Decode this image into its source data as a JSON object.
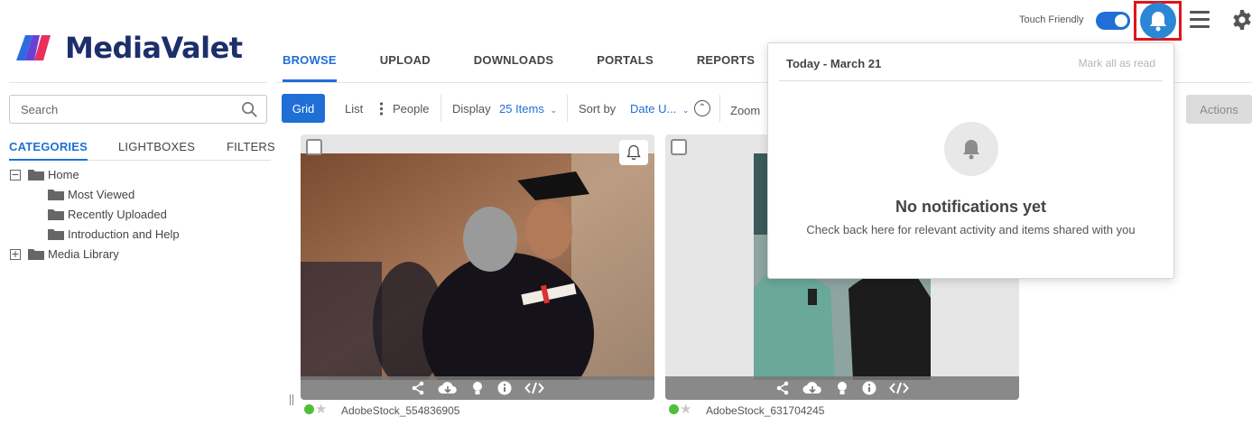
{
  "app": {
    "name": "MediaValet"
  },
  "header": {
    "nav": [
      {
        "label": "BROWSE",
        "active": true
      },
      {
        "label": "UPLOAD"
      },
      {
        "label": "DOWNLOADS"
      },
      {
        "label": "PORTALS"
      },
      {
        "label": "REPORTS"
      }
    ],
    "touch_label": "Touch Friendly",
    "touch_enabled": true,
    "icons": [
      "bell-icon",
      "hamburger-menu-icon",
      "gear-icon"
    ]
  },
  "sidebar": {
    "search_placeholder": "Search",
    "tabs": [
      {
        "label": "CATEGORIES",
        "active": true
      },
      {
        "label": "LIGHTBOXES"
      },
      {
        "label": "FILTERS"
      }
    ],
    "tree": [
      {
        "label": "Home",
        "expanded": true,
        "toggle": "−"
      },
      {
        "label": "Most Viewed"
      },
      {
        "label": "Recently Uploaded"
      },
      {
        "label": "Introduction and Help"
      },
      {
        "label": "Media Library",
        "expanded": false,
        "toggle": "+"
      }
    ]
  },
  "toolbar": {
    "grid": "Grid",
    "list": "List",
    "people": "People",
    "display_label": "Display",
    "display_value": "25 Items",
    "sort_label": "Sort by",
    "sort_value": "Date U...",
    "zoom_label": "Zoom",
    "actions": "Actions"
  },
  "assets": [
    {
      "name": "AdobeStock_554836905",
      "status_color": "#4fbf3a"
    },
    {
      "name": "AdobeStock_631704245",
      "status_color": "#4fbf3a"
    }
  ],
  "notifications": {
    "date_header": "Today - March 21",
    "mark_all": "Mark all as read",
    "empty_title": "No notifications yet",
    "empty_subtitle": "Check back here for relevant activity and items shared with you"
  },
  "colors": {
    "accent": "#1f6fd6",
    "highlight": "#e0151b",
    "brand": "#1d2f6b"
  }
}
